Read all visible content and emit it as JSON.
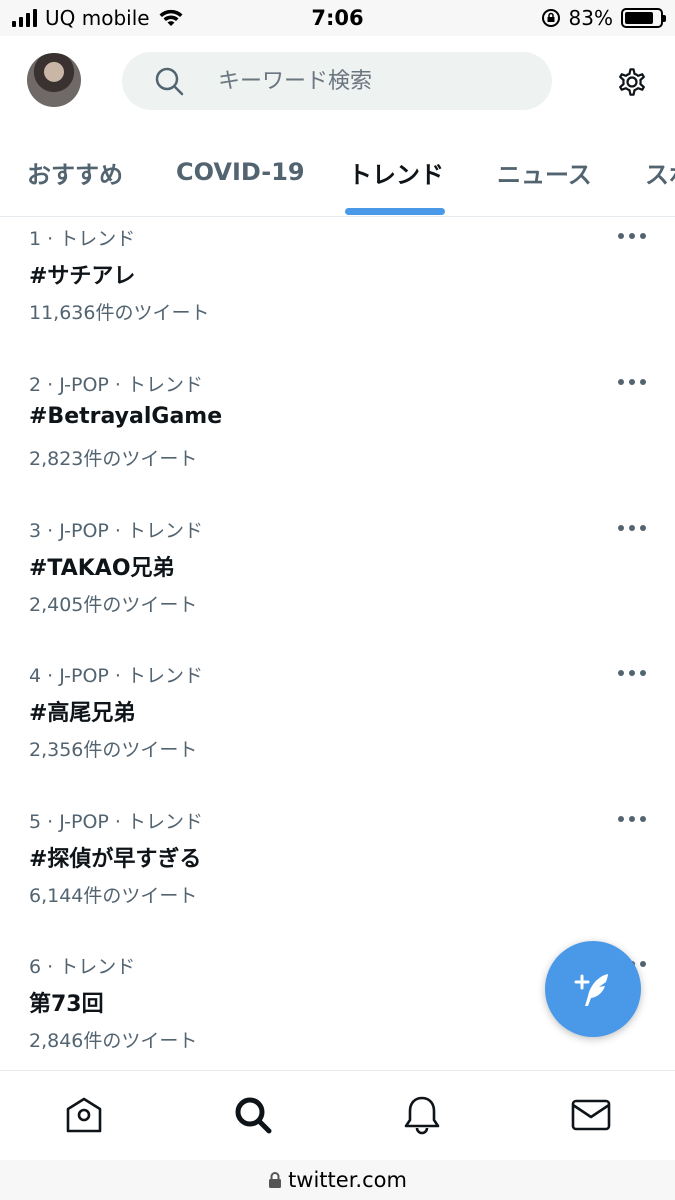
{
  "status_bar": {
    "carrier": "UQ mobile",
    "time": "7:06",
    "battery_percent": "83%",
    "battery_level": 0.83,
    "signal_icon": "signal-bars-icon",
    "wifi_icon": "wifi-icon",
    "rotation_lock_icon": "rotation-lock-icon"
  },
  "header": {
    "search_placeholder": "キーワード検索",
    "search_icon": "search-icon",
    "settings_icon": "gear-icon"
  },
  "tabs": [
    {
      "label": "おすすめ",
      "active": false
    },
    {
      "label": "COVID-19",
      "active": false
    },
    {
      "label": "トレンド",
      "active": true
    },
    {
      "label": "ニュース",
      "active": false
    },
    {
      "label": "スポ",
      "active": false
    }
  ],
  "trends": [
    {
      "meta": "1 · トレンド",
      "name": "#サチアレ",
      "count": "11,636件のツイート"
    },
    {
      "meta": "2 · J-POP · トレンド",
      "name": "#BetrayalGame",
      "count": "2,823件のツイート"
    },
    {
      "meta": "3 · J-POP · トレンド",
      "name": "#TAKAO兄弟",
      "count": "2,405件のツイート"
    },
    {
      "meta": "4 · J-POP · トレンド",
      "name": "#高尾兄弟",
      "count": "2,356件のツイート"
    },
    {
      "meta": "5 · J-POP · トレンド",
      "name": "#探偵が早すぎる",
      "count": "6,144件のツイート"
    },
    {
      "meta": "6 · トレンド",
      "name": "第73回",
      "count": "2,846件のツイート"
    }
  ],
  "fab": {
    "icon": "compose-tweet-icon"
  },
  "bottom_nav": [
    {
      "icon": "home-icon"
    },
    {
      "icon": "search-icon",
      "active": true
    },
    {
      "icon": "bell-icon"
    },
    {
      "icon": "mail-icon"
    }
  ],
  "url_bar": {
    "domain": "twitter.com",
    "icon": "lock-icon"
  },
  "colors": {
    "accent": "#4a99e9",
    "text_primary": "#0f1419",
    "text_secondary": "#536471"
  }
}
